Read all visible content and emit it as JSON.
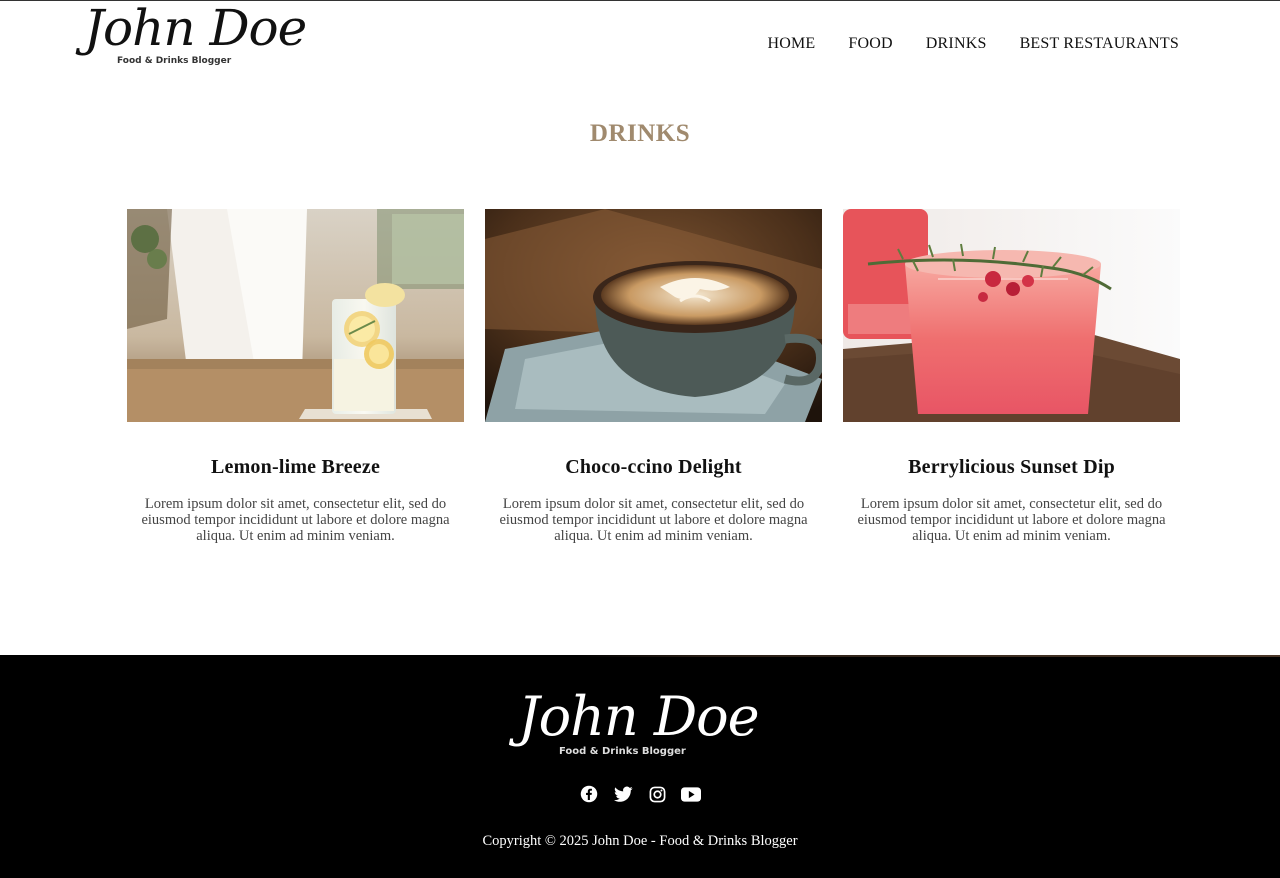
{
  "header": {
    "logo": {
      "name": "John Doe",
      "tagline": "Food & Drinks Blogger"
    },
    "nav": [
      "HOME",
      "FOOD",
      "DRINKS",
      "BEST RESTAURANTS"
    ]
  },
  "page": {
    "section_title": "DRINKS"
  },
  "cards": [
    {
      "title": "Lemon-lime Breeze",
      "description": "Lorem ipsum dolor sit amet, consectetur elit, sed do eiusmod tempor incididunt ut labore et dolore magna aliqua. Ut enim ad minim veniam."
    },
    {
      "title": "Choco-ccino Delight",
      "description": "Lorem ipsum dolor sit amet, consectetur elit, sed do eiusmod tempor incididunt ut labore et dolore magna aliqua. Ut enim ad minim veniam."
    },
    {
      "title": "Berrylicious Sunset Dip",
      "description": "Lorem ipsum dolor sit amet, consectetur elit, sed do eiusmod tempor incididunt ut labore et dolore magna aliqua. Ut enim ad minim veniam."
    }
  ],
  "footer": {
    "logo": {
      "name": "John Doe",
      "tagline": "Food & Drinks Blogger"
    },
    "social_icons": [
      "facebook-icon",
      "twitter-icon",
      "instagram-icon",
      "youtube-icon"
    ],
    "copyright": "Copyright © 2025 John Doe - Food & Drinks Blogger"
  },
  "colors": {
    "accent": "#a08a6e",
    "footer_bg": "#000000",
    "text": "#111111"
  }
}
